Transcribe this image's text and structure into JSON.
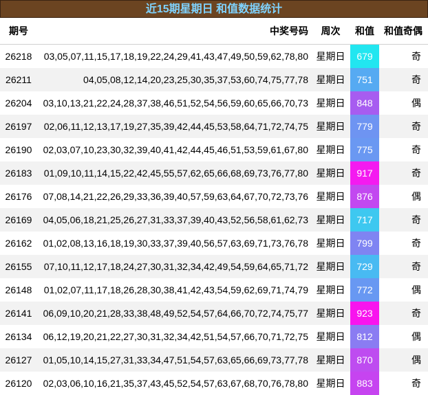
{
  "title": "近15期星期日 和值数据统计",
  "headers": {
    "issue": "期号",
    "numbers": "中奖号码",
    "weekday": "周次",
    "sum": "和值",
    "odd_even": "和值奇偶"
  },
  "rows": [
    {
      "issue": "26218",
      "numbers": "03,05,07,11,15,17,18,19,22,24,29,41,43,47,49,50,59,62,78,80",
      "weekday": "星期日",
      "sum": "679",
      "sum_color": "#22e6f0",
      "odd_even": "奇"
    },
    {
      "issue": "26211",
      "numbers": "04,05,08,12,14,20,23,25,30,35,37,53,60,74,75,77,78",
      "weekday": "星期日",
      "sum": "751",
      "sum_color": "#56aaf2",
      "odd_even": "奇"
    },
    {
      "issue": "26204",
      "numbers": "03,10,13,21,22,24,28,37,38,46,51,52,54,56,59,60,65,66,70,73",
      "weekday": "星期日",
      "sum": "848",
      "sum_color": "#a75cf0",
      "odd_even": "偶"
    },
    {
      "issue": "26197",
      "numbers": "02,06,11,12,13,17,19,27,35,39,42,44,45,53,58,64,71,72,74,75",
      "weekday": "星期日",
      "sum": "779",
      "sum_color": "#6e94f2",
      "odd_even": "奇"
    },
    {
      "issue": "26190",
      "numbers": "02,03,07,10,23,30,32,39,40,41,42,44,45,46,51,53,59,61,67,80",
      "weekday": "星期日",
      "sum": "775",
      "sum_color": "#6a98f2",
      "odd_even": "奇"
    },
    {
      "issue": "26183",
      "numbers": "01,09,10,11,14,15,22,42,45,55,57,62,65,66,68,69,73,76,77,80",
      "weekday": "星期日",
      "sum": "917",
      "sum_color": "#f41af0",
      "odd_even": "奇"
    },
    {
      "issue": "26176",
      "numbers": "07,08,14,21,22,26,29,33,36,39,40,57,59,63,64,67,70,72,73,76",
      "weekday": "星期日",
      "sum": "876",
      "sum_color": "#c248f0",
      "odd_even": "偶"
    },
    {
      "issue": "26169",
      "numbers": "04,05,06,18,21,25,26,27,31,33,37,39,40,43,52,56,58,61,62,73",
      "weekday": "星期日",
      "sum": "717",
      "sum_color": "#3ec8f0",
      "odd_even": "奇"
    },
    {
      "issue": "26162",
      "numbers": "01,02,08,13,16,18,19,30,33,37,39,40,56,57,63,69,71,73,76,78",
      "weekday": "星期日",
      "sum": "799",
      "sum_color": "#7f84f2",
      "odd_even": "奇"
    },
    {
      "issue": "26155",
      "numbers": "07,10,11,12,17,18,24,27,30,31,32,34,42,49,54,59,64,65,71,72",
      "weekday": "星期日",
      "sum": "729",
      "sum_color": "#48baf2",
      "odd_even": "奇"
    },
    {
      "issue": "26148",
      "numbers": "01,02,07,11,17,18,26,28,30,38,41,42,43,54,59,62,69,71,74,79",
      "weekday": "星期日",
      "sum": "772",
      "sum_color": "#6898f2",
      "odd_even": "偶"
    },
    {
      "issue": "26141",
      "numbers": "06,09,10,20,21,28,33,38,48,49,52,54,57,64,66,70,72,74,75,77",
      "weekday": "星期日",
      "sum": "923",
      "sum_color": "#f814ee",
      "odd_even": "奇"
    },
    {
      "issue": "26134",
      "numbers": "06,12,19,20,21,22,27,30,31,32,34,42,51,54,57,66,70,71,72,75",
      "weekday": "星期日",
      "sum": "812",
      "sum_color": "#8a7cf2",
      "odd_even": "偶"
    },
    {
      "issue": "26127",
      "numbers": "01,05,10,14,15,27,31,33,34,47,51,54,57,63,65,66,69,73,77,78",
      "weekday": "星期日",
      "sum": "870",
      "sum_color": "#be4cf0",
      "odd_even": "偶"
    },
    {
      "issue": "26120",
      "numbers": "02,03,06,10,16,21,35,37,43,45,52,54,57,63,67,68,70,76,78,80",
      "weekday": "星期日",
      "sum": "883",
      "sum_color": "#c644f0",
      "odd_even": "奇"
    }
  ]
}
